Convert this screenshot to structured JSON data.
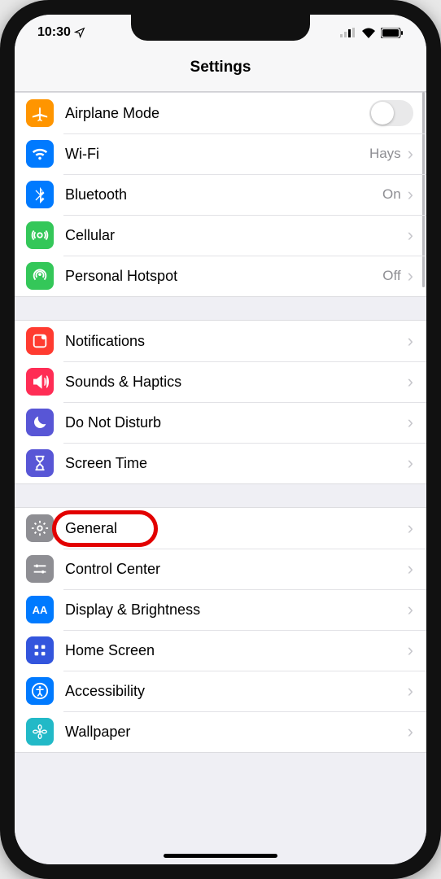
{
  "status": {
    "time": "10:30"
  },
  "header": {
    "title": "Settings"
  },
  "groups": [
    {
      "rows": [
        {
          "id": "airplane",
          "label": "Airplane Mode",
          "type": "toggle",
          "value": false,
          "icon": "airplane",
          "color": "#ff9500"
        },
        {
          "id": "wifi",
          "label": "Wi-Fi",
          "type": "disclosure",
          "value": "Hays",
          "icon": "wifi",
          "color": "#007aff"
        },
        {
          "id": "bluetooth",
          "label": "Bluetooth",
          "type": "disclosure",
          "value": "On",
          "icon": "bluetooth",
          "color": "#007aff"
        },
        {
          "id": "cellular",
          "label": "Cellular",
          "type": "disclosure",
          "value": "",
          "icon": "cellular",
          "color": "#34c759"
        },
        {
          "id": "hotspot",
          "label": "Personal Hotspot",
          "type": "disclosure",
          "value": "Off",
          "icon": "hotspot",
          "color": "#34c759"
        }
      ]
    },
    {
      "rows": [
        {
          "id": "notifications",
          "label": "Notifications",
          "type": "disclosure",
          "value": "",
          "icon": "notifications",
          "color": "#ff3b30"
        },
        {
          "id": "sounds",
          "label": "Sounds & Haptics",
          "type": "disclosure",
          "value": "",
          "icon": "sounds",
          "color": "#ff2d55"
        },
        {
          "id": "dnd",
          "label": "Do Not Disturb",
          "type": "disclosure",
          "value": "",
          "icon": "dnd",
          "color": "#5856d6"
        },
        {
          "id": "screentime",
          "label": "Screen Time",
          "type": "disclosure",
          "value": "",
          "icon": "screentime",
          "color": "#5856d6"
        }
      ]
    },
    {
      "rows": [
        {
          "id": "general",
          "label": "General",
          "type": "disclosure",
          "value": "",
          "icon": "gear",
          "color": "#8e8e93",
          "highlighted": true
        },
        {
          "id": "controlcenter",
          "label": "Control Center",
          "type": "disclosure",
          "value": "",
          "icon": "controlcenter",
          "color": "#8e8e93"
        },
        {
          "id": "display",
          "label": "Display & Brightness",
          "type": "disclosure",
          "value": "",
          "icon": "display",
          "color": "#007aff"
        },
        {
          "id": "homescreen",
          "label": "Home Screen",
          "type": "disclosure",
          "value": "",
          "icon": "homescreen",
          "color": "#3355dd"
        },
        {
          "id": "accessibility",
          "label": "Accessibility",
          "type": "disclosure",
          "value": "",
          "icon": "accessibility",
          "color": "#007aff"
        },
        {
          "id": "wallpaper",
          "label": "Wallpaper",
          "type": "disclosure",
          "value": "",
          "icon": "wallpaper",
          "color": "#22b9c7"
        }
      ]
    }
  ]
}
